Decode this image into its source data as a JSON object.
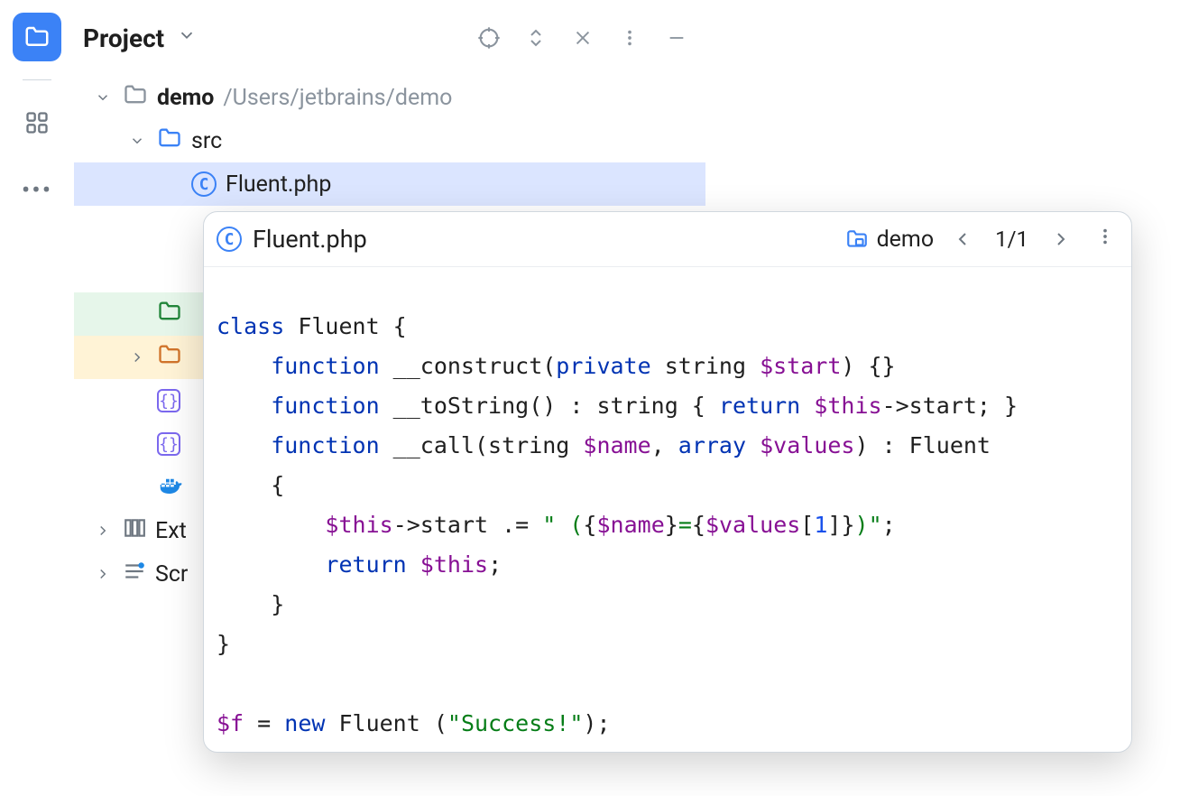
{
  "rail": {
    "active_icon": "folder",
    "icons": [
      "folder",
      "widgets",
      "more"
    ]
  },
  "panel": {
    "title": "Project"
  },
  "tree": {
    "root": {
      "name": "demo",
      "path": "/Users/jetbrains/demo"
    },
    "src": "src",
    "selected_file": "Fluent.php",
    "ext_label": "Ext",
    "scr_label": "Scr"
  },
  "popup": {
    "file_name": "Fluent.php",
    "crumb": "demo",
    "nav_pos": "1/1"
  },
  "code": {
    "l1a": "class",
    "l1b": " Fluent {",
    "l2a": "    function",
    "l2b": " __construct(",
    "l2c": "private",
    "l2d": " string ",
    "l2e": "$start",
    "l2f": ") {}",
    "l3a": "    function",
    "l3b": " __toString() : string { ",
    "l3c": "return",
    "l3d": " ",
    "l3e": "$this",
    "l3f": "->start; }",
    "l4a": "    function",
    "l4b": " __call(string ",
    "l4c": "$name",
    "l4d": ", ",
    "l4e": "array",
    "l4f": " ",
    "l4g": "$values",
    "l4h": ") : Fluent",
    "l5": "    {",
    "l6a": "        ",
    "l6b": "$this",
    "l6c": "->start .= ",
    "l6d": "\" (",
    "l6e": "{",
    "l6f": "$name",
    "l6g": "}",
    "l6h": "=",
    "l6i": "{",
    "l6j": "$values",
    "l6k": "[",
    "l6l": "1",
    "l6m": "]}",
    "l6n": ")\"",
    "l6o": ";",
    "l7a": "        ",
    "l7b": "return",
    "l7c": " ",
    "l7d": "$this",
    "l7e": ";",
    "l8": "    }",
    "l9": "}",
    "l10": "",
    "l11a": "$f",
    "l11b": " = ",
    "l11c": "new",
    "l11d": " Fluent (",
    "l11e": "\"Success!\"",
    "l11f": ");"
  }
}
